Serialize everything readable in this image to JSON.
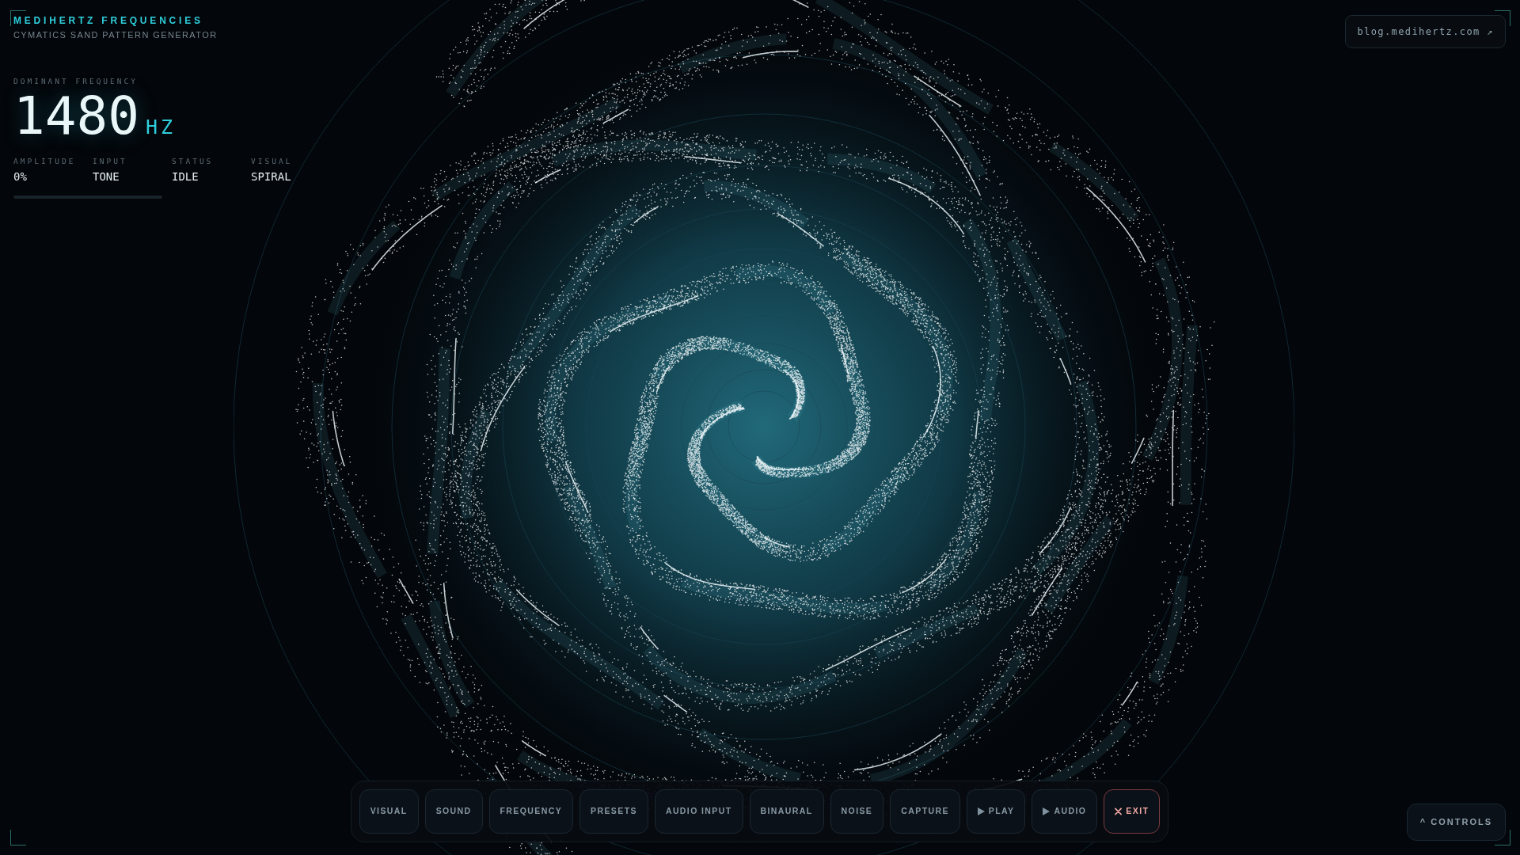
{
  "header": {
    "title": "MEDIHERTZ FREQUENCIES",
    "subtitle": "CYMATICS SAND PATTERN GENERATOR"
  },
  "readout": {
    "label": "DOMINANT FREQUENCY",
    "value": "1480",
    "unit": "HZ"
  },
  "stats": [
    {
      "label": "AMPLITUDE",
      "value": "0%"
    },
    {
      "label": "INPUT",
      "value": "TONE"
    },
    {
      "label": "STATUS",
      "value": "IDLE"
    },
    {
      "label": "VISUAL",
      "value": "SPIRAL"
    }
  ],
  "amplitude_meter": {
    "level": 0
  },
  "link": {
    "label": "blog.medihertz.com ↗"
  },
  "toolbar": [
    {
      "label": "VISUAL",
      "kind": "plain"
    },
    {
      "label": "SOUND",
      "kind": "plain"
    },
    {
      "label": "FREQUENCY",
      "kind": "plain"
    },
    {
      "label": "PRESETS",
      "kind": "plain"
    },
    {
      "label": "AUDIO INPUT",
      "kind": "plain"
    },
    {
      "label": "BINAURAL",
      "kind": "plain"
    },
    {
      "label": "NOISE",
      "kind": "plain"
    },
    {
      "label": "CAPTURE",
      "kind": "plain"
    },
    {
      "label": "PLAY",
      "kind": "play"
    },
    {
      "label": "AUDIO",
      "kind": "play"
    },
    {
      "label": "EXIT",
      "kind": "exit"
    }
  ],
  "controls_button": {
    "label": "^ CONTROLS"
  }
}
